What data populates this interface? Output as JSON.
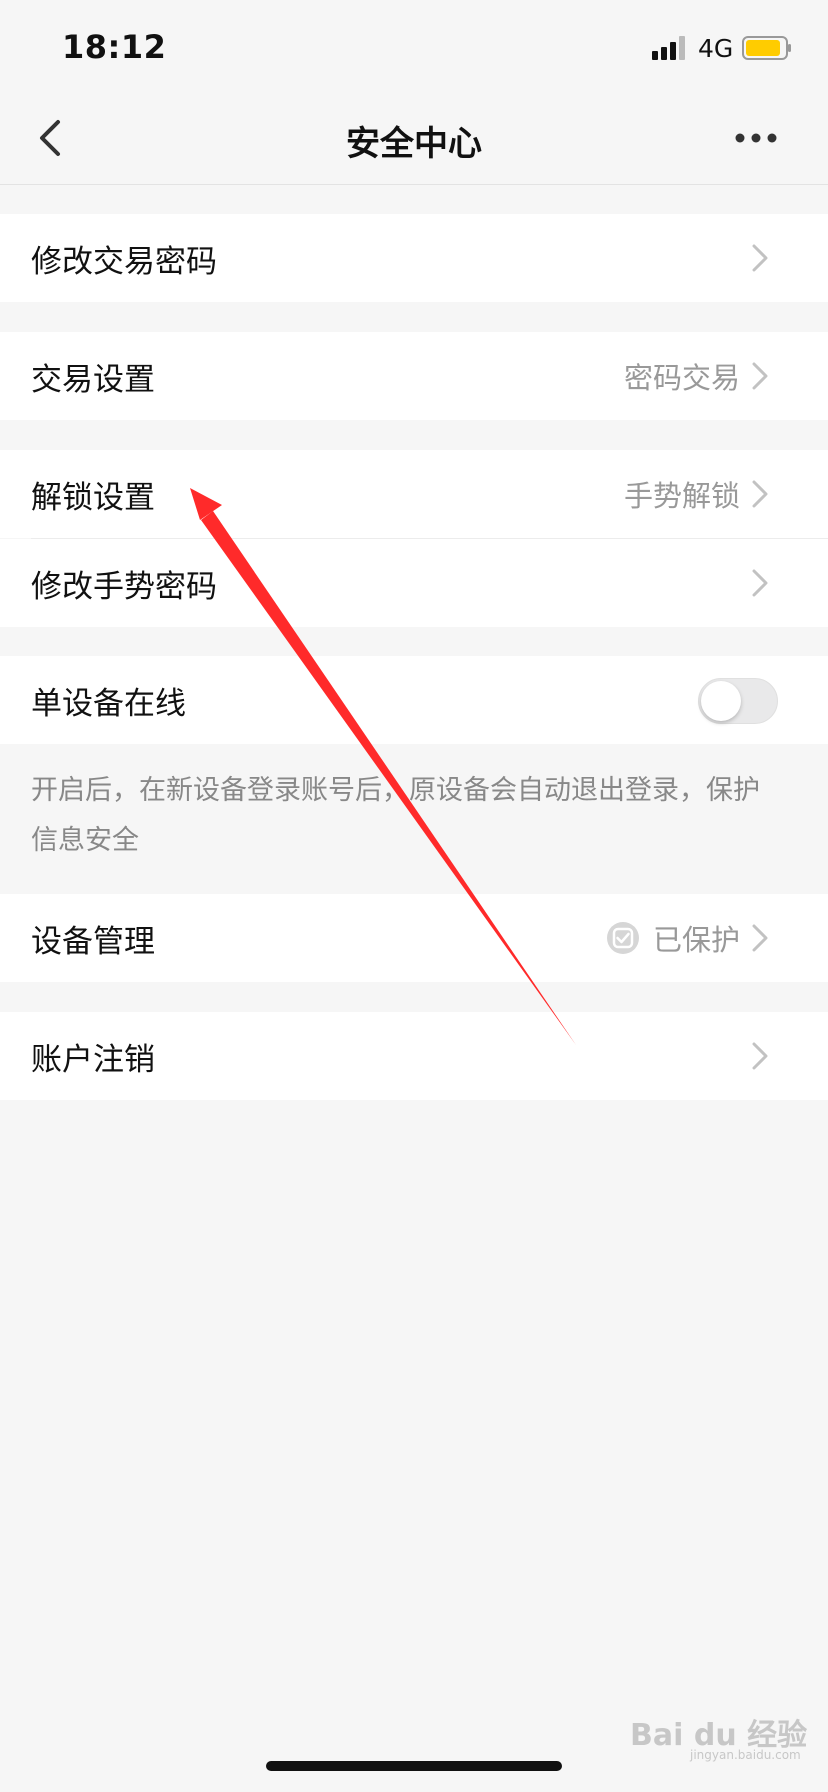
{
  "status_bar": {
    "time": "18:12",
    "network": "4G",
    "battery_color": "#FFCC00"
  },
  "nav": {
    "title": "安全中心",
    "back_icon": "chevron-left-icon",
    "more_icon": "more-dots-icon"
  },
  "rows": {
    "change_trade_password": {
      "label": "修改交易密码"
    },
    "trade_settings": {
      "label": "交易设置",
      "value": "密码交易"
    },
    "unlock_settings": {
      "label": "解锁设置",
      "value": "手势解锁"
    },
    "change_gesture_password": {
      "label": "修改手势密码"
    },
    "single_device_online": {
      "label": "单设备在线",
      "enabled": false
    },
    "device_management": {
      "label": "设备管理",
      "value": "已保护",
      "icon": "shield-check-icon"
    },
    "account_cancel": {
      "label": "账户注销"
    }
  },
  "single_device_note": "开启后，在新设备登录账号后，原设备会自动退出登录，保护信息安全",
  "annotation": {
    "color": "#FF2A2A"
  },
  "watermark": {
    "brand": "Bai du 经验",
    "url": "jingyan.baidu.com"
  }
}
